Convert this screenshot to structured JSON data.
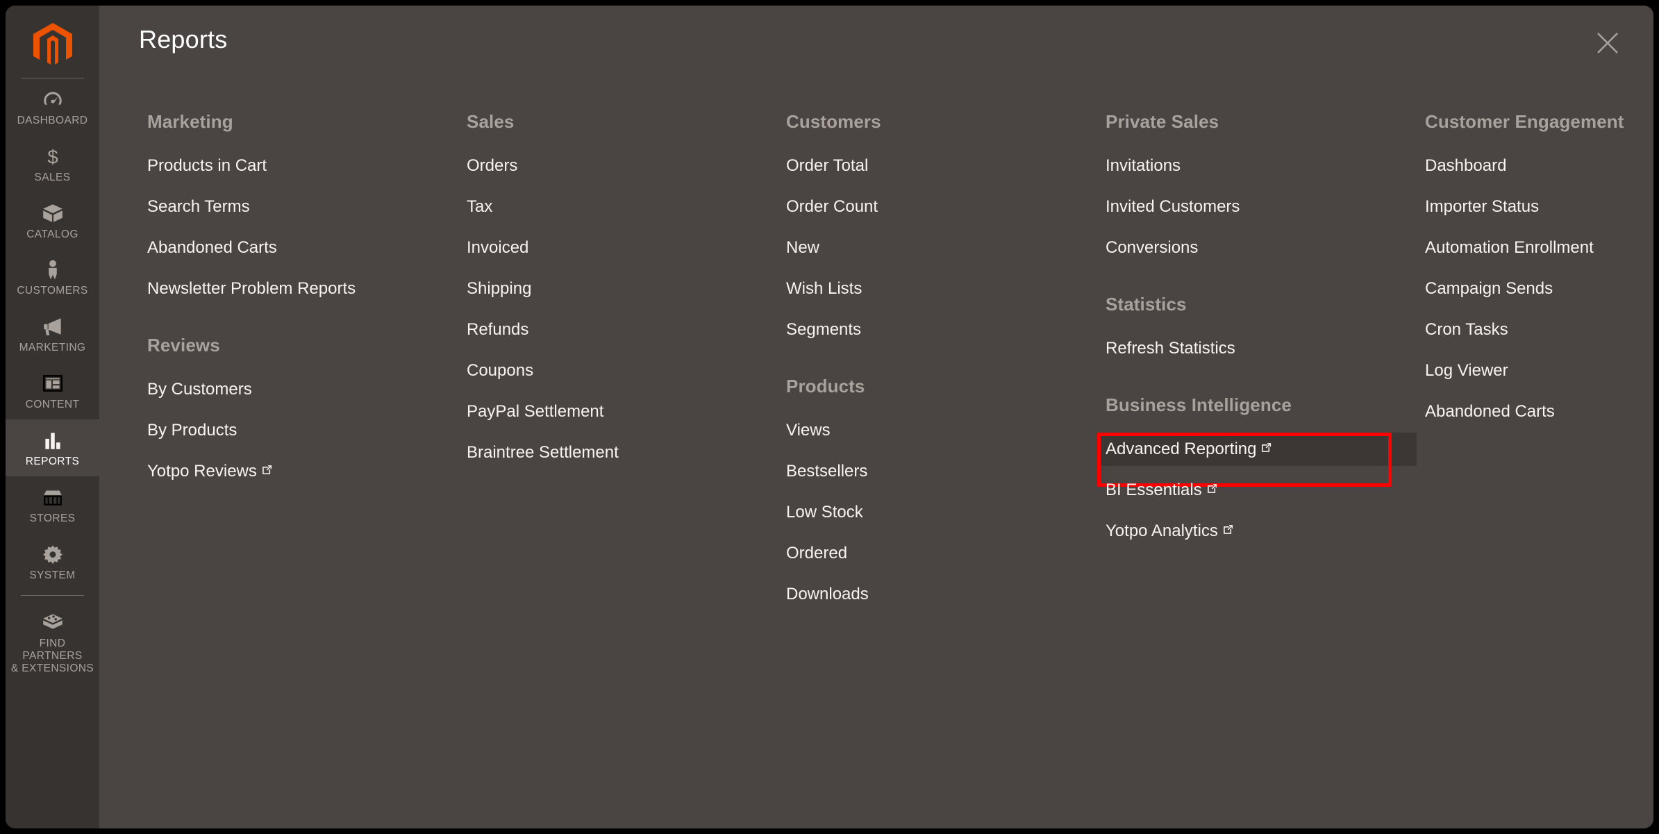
{
  "colors": {
    "panel_bg": "#4a4542",
    "sidebar_bg": "#373330",
    "accent_orange": "#eb5202",
    "text_primary": "#f7f3ef",
    "text_muted": "#a9a29c",
    "highlight_border": "#ff0000",
    "hover_bg": "#3c3734"
  },
  "header": {
    "title": "Reports",
    "close_icon": "close-icon"
  },
  "sidebar": {
    "logo_icon": "magento-logo-icon",
    "items": [
      {
        "label": "DASHBOARD",
        "icon": "gauge-icon",
        "active": false
      },
      {
        "label": "SALES",
        "icon": "dollar-icon",
        "active": false
      },
      {
        "label": "CATALOG",
        "icon": "box-icon",
        "active": false
      },
      {
        "label": "CUSTOMERS",
        "icon": "person-icon",
        "active": false
      },
      {
        "label": "MARKETING",
        "icon": "megaphone-icon",
        "active": false
      },
      {
        "label": "CONTENT",
        "icon": "layout-icon",
        "active": false
      },
      {
        "label": "REPORTS",
        "icon": "bar-chart-icon",
        "active": true
      },
      {
        "label": "STORES",
        "icon": "storefront-icon",
        "active": false
      },
      {
        "label": "SYSTEM",
        "icon": "gear-icon",
        "active": false
      },
      {
        "label": "FIND PARTNERS\n& EXTENSIONS",
        "icon": "blocks-icon",
        "active": false
      }
    ]
  },
  "columns": [
    {
      "groups": [
        {
          "title": "Marketing",
          "items": [
            {
              "label": "Products in Cart",
              "external": false
            },
            {
              "label": "Search Terms",
              "external": false
            },
            {
              "label": "Abandoned Carts",
              "external": false
            },
            {
              "label": "Newsletter Problem Reports",
              "external": false
            }
          ]
        },
        {
          "title": "Reviews",
          "items": [
            {
              "label": "By Customers",
              "external": false
            },
            {
              "label": "By Products",
              "external": false
            },
            {
              "label": "Yotpo Reviews",
              "external": true
            }
          ]
        }
      ]
    },
    {
      "groups": [
        {
          "title": "Sales",
          "items": [
            {
              "label": "Orders",
              "external": false
            },
            {
              "label": "Tax",
              "external": false
            },
            {
              "label": "Invoiced",
              "external": false
            },
            {
              "label": "Shipping",
              "external": false
            },
            {
              "label": "Refunds",
              "external": false
            },
            {
              "label": "Coupons",
              "external": false
            },
            {
              "label": "PayPal Settlement",
              "external": false
            },
            {
              "label": "Braintree Settlement",
              "external": false
            }
          ]
        }
      ]
    },
    {
      "groups": [
        {
          "title": "Customers",
          "items": [
            {
              "label": "Order Total",
              "external": false
            },
            {
              "label": "Order Count",
              "external": false
            },
            {
              "label": "New",
              "external": false
            },
            {
              "label": "Wish Lists",
              "external": false
            },
            {
              "label": "Segments",
              "external": false
            }
          ]
        },
        {
          "title": "Products",
          "items": [
            {
              "label": "Views",
              "external": false
            },
            {
              "label": "Bestsellers",
              "external": false
            },
            {
              "label": "Low Stock",
              "external": false
            },
            {
              "label": "Ordered",
              "external": false
            },
            {
              "label": "Downloads",
              "external": false
            }
          ]
        }
      ]
    },
    {
      "groups": [
        {
          "title": "Private Sales",
          "items": [
            {
              "label": "Invitations",
              "external": false
            },
            {
              "label": "Invited Customers",
              "external": false
            },
            {
              "label": "Conversions",
              "external": false
            }
          ]
        },
        {
          "title": "Statistics",
          "items": [
            {
              "label": "Refresh Statistics",
              "external": false
            }
          ]
        },
        {
          "title": "Business Intelligence",
          "items": [
            {
              "label": "Advanced Reporting",
              "external": true,
              "highlighted": true,
              "hovered": true
            },
            {
              "label": "BI Essentials",
              "external": true
            },
            {
              "label": "Yotpo Analytics",
              "external": true
            }
          ]
        }
      ]
    },
    {
      "groups": [
        {
          "title": "Customer Engagement",
          "items": [
            {
              "label": "Dashboard",
              "external": false
            },
            {
              "label": "Importer Status",
              "external": false
            },
            {
              "label": "Automation Enrollment",
              "external": false
            },
            {
              "label": "Campaign Sends",
              "external": false
            },
            {
              "label": "Cron Tasks",
              "external": false
            },
            {
              "label": "Log Viewer",
              "external": false
            },
            {
              "label": "Abandoned Carts",
              "external": false
            }
          ]
        }
      ]
    }
  ]
}
